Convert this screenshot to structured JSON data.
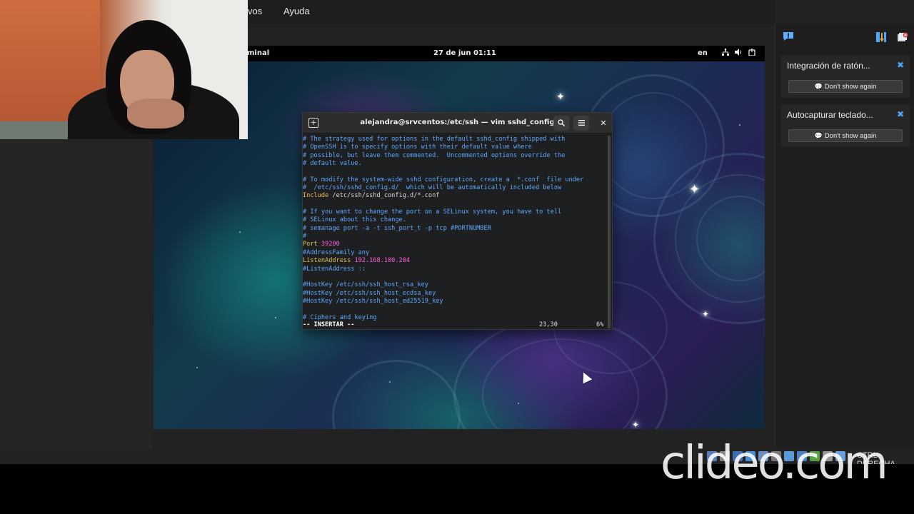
{
  "host_menu": {
    "items": [
      "vos",
      "Ayuda"
    ]
  },
  "gnome_bar": {
    "app_name": "minal",
    "clock": "27 de jun  01:11",
    "language": "en",
    "icons": [
      "network-icon",
      "volume-icon",
      "power-icon"
    ]
  },
  "terminal": {
    "title": "alejandra@srvcentos:/etc/ssh — vim sshd_config",
    "lines": [
      {
        "parts": [
          {
            "t": "# The strategy used for options in the default sshd_config shipped with",
            "c": "comment"
          }
        ]
      },
      {
        "parts": [
          {
            "t": "# OpenSSH is to specify options with their default value where",
            "c": "comment"
          }
        ]
      },
      {
        "parts": [
          {
            "t": "# possible, but leave them commented.  Uncommented options override the",
            "c": "comment"
          }
        ]
      },
      {
        "parts": [
          {
            "t": "# default value.",
            "c": "comment"
          }
        ]
      },
      {
        "parts": []
      },
      {
        "parts": [
          {
            "t": "# To modify the system-wide sshd configuration, create a  *.conf  file under",
            "c": "comment"
          }
        ]
      },
      {
        "parts": [
          {
            "t": "#  /etc/ssh/sshd_config.d/  which will be automatically included below",
            "c": "comment"
          }
        ]
      },
      {
        "parts": [
          {
            "t": "Include",
            "c": "kw"
          },
          {
            "t": " /etc/ssh/sshd_config.d/*.conf",
            "c": "plain"
          }
        ]
      },
      {
        "parts": []
      },
      {
        "parts": [
          {
            "t": "# If you want to change the port on a SELinux system, you have to tell",
            "c": "comment"
          }
        ]
      },
      {
        "parts": [
          {
            "t": "# SELinux about this change.",
            "c": "comment"
          }
        ]
      },
      {
        "parts": [
          {
            "t": "# semanage port -a -t ssh_port_t -p tcp #PORTNUMBER",
            "c": "comment"
          }
        ]
      },
      {
        "parts": [
          {
            "t": "#",
            "c": "comment"
          }
        ]
      },
      {
        "parts": [
          {
            "t": "Port",
            "c": "kw"
          },
          {
            "t": " 39200",
            "c": "val"
          }
        ]
      },
      {
        "parts": [
          {
            "t": "#AddressFamily any",
            "c": "comment"
          }
        ]
      },
      {
        "parts": [
          {
            "t": "ListenAddress",
            "c": "kw"
          },
          {
            "t": " 192.168.100.204",
            "c": "val"
          }
        ]
      },
      {
        "parts": [
          {
            "t": "#ListenAddress ::",
            "c": "comment"
          }
        ]
      },
      {
        "parts": []
      },
      {
        "parts": [
          {
            "t": "#HostKey /etc/ssh/ssh_host_rsa_key",
            "c": "comment"
          }
        ]
      },
      {
        "parts": [
          {
            "t": "#HostKey /etc/ssh/ssh_host_ecdsa_key",
            "c": "comment"
          }
        ]
      },
      {
        "parts": [
          {
            "t": "#HostKey /etc/ssh/ssh_host_ed25519_key",
            "c": "comment"
          }
        ]
      },
      {
        "parts": []
      },
      {
        "parts": [
          {
            "t": "# Ciphers and keying",
            "c": "comment"
          }
        ]
      }
    ],
    "status": {
      "mode": "-- INSERTAR --",
      "position": "23,30",
      "percent": "6%"
    }
  },
  "notifications": [
    {
      "title": "Integración de ratón...",
      "button": "Don't show again"
    },
    {
      "title": "Autocapturar teclado...",
      "button": "Don't show again"
    }
  ],
  "status_bar": {
    "host_key": "CTRL DERECHA"
  },
  "watermark": "clideo.com",
  "colors": {
    "comment": "#5fa8ff",
    "keyword": "#e5c05b",
    "value": "#ff5fd7",
    "accent": "#4aa8ff"
  }
}
